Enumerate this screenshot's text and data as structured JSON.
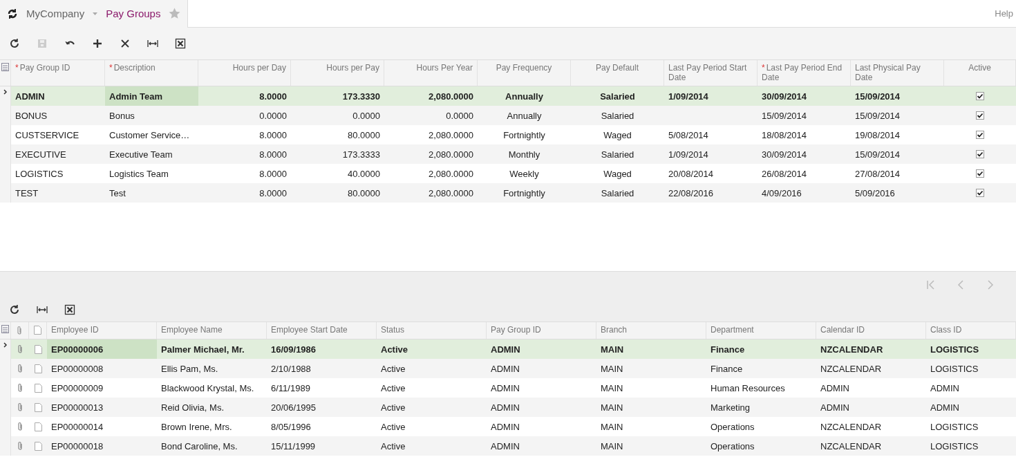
{
  "header": {
    "company": "MyCompany",
    "screen": "Pay Groups",
    "help": "Help"
  },
  "pay_groups": {
    "columns": [
      {
        "label": "Pay Group ID",
        "required_mark": "*"
      },
      {
        "label": "Description",
        "required_mark": "*"
      },
      {
        "label": "Hours per Day"
      },
      {
        "label": "Hours per Pay"
      },
      {
        "label": "Hours Per Year"
      },
      {
        "label": "Pay Frequency"
      },
      {
        "label": "Pay Default"
      },
      {
        "label": "Last Pay Period Start Date"
      },
      {
        "label": "Last Pay Period End Date",
        "required_mark": "*"
      },
      {
        "label": "Last Physical Pay Date"
      },
      {
        "label": "Active"
      }
    ],
    "rows": [
      {
        "selected": true,
        "cells": [
          "ADMIN",
          {
            "text": "Admin Team",
            "focused": true
          },
          "8.0000",
          "173.3330",
          "2,080.0000",
          "Annually",
          "Salaried",
          "1/09/2014",
          "30/09/2014",
          "15/09/2014"
        ],
        "active": true
      },
      {
        "selected": false,
        "cells": [
          "BONUS",
          "Bonus",
          "0.0000",
          "0.0000",
          "0.0000",
          "Annually",
          "Salaried",
          null,
          "15/09/2014",
          "15/09/2014"
        ],
        "active": true
      },
      {
        "selected": false,
        "cells": [
          "CUSTSERVICE",
          "Customer Service…",
          "8.0000",
          "80.0000",
          "2,080.0000",
          "Fortnightly",
          "Waged",
          "5/08/2014",
          "18/08/2014",
          "19/08/2014"
        ],
        "active": true
      },
      {
        "selected": false,
        "cells": [
          "EXECUTIVE",
          "Executive Team",
          "8.0000",
          "173.3333",
          "2,080.0000",
          "Monthly",
          "Salaried",
          "1/09/2014",
          "30/09/2014",
          "15/09/2014"
        ],
        "active": true
      },
      {
        "selected": false,
        "cells": [
          "LOGISTICS",
          "Logistics Team",
          "8.0000",
          "40.0000",
          "2,080.0000",
          "Weekly",
          "Waged",
          "20/08/2014",
          "26/08/2014",
          "27/08/2014"
        ],
        "active": true
      },
      {
        "selected": false,
        "cells": [
          "TEST",
          "Test",
          "8.0000",
          "80.0000",
          "2,080.0000",
          "Fortnightly",
          "Salaried",
          "22/08/2016",
          "4/09/2016",
          "5/09/2016"
        ],
        "active": true
      }
    ]
  },
  "employees": {
    "columns": [
      "Employee ID",
      "Employee Name",
      "Employee Start Date",
      "Status",
      "Pay Group ID",
      "Branch",
      "Department",
      "Calendar ID",
      "Class ID"
    ],
    "rows": [
      {
        "selected": true,
        "cells": [
          {
            "text": "EP00000006",
            "focused": true
          },
          "Palmer Michael, Mr.",
          "16/09/1986",
          "Active",
          "ADMIN",
          "MAIN",
          "Finance",
          "NZCALENDAR",
          "LOGISTICS"
        ]
      },
      {
        "selected": false,
        "cells": [
          "EP00000008",
          "Ellis Pam, Ms.",
          "2/10/1988",
          "Active",
          "ADMIN",
          "MAIN",
          "Finance",
          "NZCALENDAR",
          "LOGISTICS"
        ]
      },
      {
        "selected": false,
        "cells": [
          "EP00000009",
          "Blackwood Krystal, Ms.",
          "6/11/1989",
          "Active",
          "ADMIN",
          "MAIN",
          "Human Resources",
          "ADMIN",
          "ADMIN"
        ]
      },
      {
        "selected": false,
        "cells": [
          "EP00000013",
          "Reid Olivia, Ms.",
          "20/06/1995",
          "Active",
          "ADMIN",
          "MAIN",
          "Marketing",
          "ADMIN",
          "ADMIN"
        ]
      },
      {
        "selected": false,
        "cells": [
          "EP00000014",
          "Brown Irene, Mrs.",
          "8/05/1996",
          "Active",
          "ADMIN",
          "MAIN",
          "Operations",
          "NZCALENDAR",
          "LOGISTICS"
        ]
      },
      {
        "selected": false,
        "cells": [
          "EP00000018",
          "Bond Caroline, Ms.",
          "15/11/1999",
          "Active",
          "ADMIN",
          "MAIN",
          "Operations",
          "NZCALENDAR",
          "LOGISTICS"
        ]
      }
    ]
  }
}
